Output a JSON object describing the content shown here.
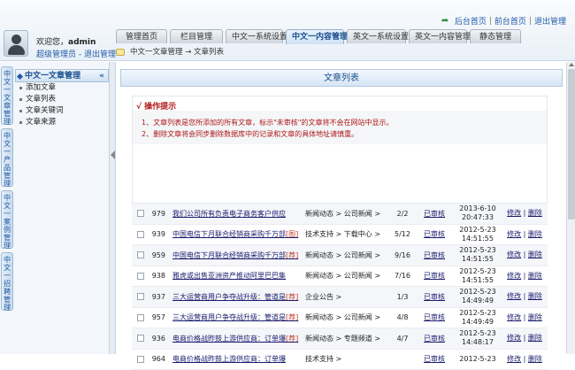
{
  "top": {
    "welcome_prefix": "欢迎您，",
    "username": "admin",
    "role": "超级管理员",
    "logout_inline": "退出管理",
    "links": [
      "后台首页",
      "前台首页",
      "退出管理"
    ]
  },
  "tabs": [
    {
      "label": "管理首页",
      "active": false
    },
    {
      "label": "栏目管理",
      "active": false
    },
    {
      "label": "中文一系统设置",
      "active": false
    },
    {
      "label": "中文一内容管理",
      "active": true
    },
    {
      "label": "英文一系统设置",
      "active": false
    },
    {
      "label": "英文一内容管理",
      "active": false
    },
    {
      "label": "静态管理",
      "active": false
    }
  ],
  "breadcrumb": "中文一文章管理 → 文章列表",
  "nav": {
    "vertical_tabs": [
      "中文一文章管理",
      "中文一产品管理",
      "中文一案例管理",
      "中文一招聘管理"
    ],
    "section_title": "中文一文章管理",
    "items": [
      "添加文章",
      "文章列表",
      "文章关键词",
      "文章来源"
    ]
  },
  "main": {
    "header": "文章列表",
    "notice_title": "操作提示",
    "notice_lines": [
      "1、文章列表是您所添加的所有文章，标示\"未审核\"的文章将不会在网站中显示。",
      "2、删除文章将会同步删除数据库中的记录和文章的具体地址请慎重。"
    ],
    "rows": [
      {
        "id": "979",
        "title": "我们公司所有负责电子商务客户供应",
        "tag": "",
        "category": "新闻动态 > 公司新闻 >",
        "count": "2/2",
        "status": "已审核",
        "date": "2013-6-10",
        "time": "20:47:33",
        "edit": "修改",
        "del": "删除"
      },
      {
        "id": "939",
        "title": "中国电信下月联合经销商采购千万部",
        "tag": "[图]",
        "category": "技术支持 > 下载中心 >",
        "count": "5/12",
        "status": "已审核",
        "date": "2012-5-23",
        "time": "14:51:55",
        "edit": "修改",
        "del": "删除"
      },
      {
        "id": "959",
        "title": "中国电信下月联合经销商采购千万部",
        "tag": "[荐]",
        "category": "新闻动态 > 公司新闻 >",
        "count": "9/16",
        "status": "已审核",
        "date": "2012-5-23",
        "time": "14:51:55",
        "edit": "修改",
        "del": "删除"
      },
      {
        "id": "938",
        "title": "雅虎或出售亚洲资产推动阿里巴巴集",
        "tag": "",
        "category": "新闻动态 > 公司新闻 >",
        "count": "7/16",
        "status": "已审核",
        "date": "2012-5-23",
        "time": "14:51:55",
        "edit": "修改",
        "del": "删除"
      },
      {
        "id": "937",
        "title": "三大运营商用户争夺战升级：管道是",
        "tag": "[荐]",
        "category": "企业公告 >",
        "count": "1/3",
        "status": "已审核",
        "date": "2012-5-23",
        "time": "14:49:49",
        "edit": "修改",
        "del": "删除"
      },
      {
        "id": "957",
        "title": "三大运营商用户争夺战升级：管道是",
        "tag": "[荐]",
        "category": "新闻动态 > 公司新闻 >",
        "count": "4/8",
        "status": "已审核",
        "date": "2012-5-23",
        "time": "14:49:49",
        "edit": "修改",
        "del": "删除"
      },
      {
        "id": "936",
        "title": "电商价格战昨鼓上游供应商：订单爆",
        "tag": "[荐]",
        "category": "新闻动态 > 专题频道 >",
        "count": "4/7",
        "status": "已审核",
        "date": "2012-5-23",
        "time": "14:48:17",
        "edit": "修改",
        "del": "删除"
      },
      {
        "id": "964",
        "title": "电商价格战昨鼓上游供应商：订单爆",
        "tag": "",
        "category": "技术支持 >",
        "count": "",
        "status": "已审核",
        "date": "2012-5-23",
        "time": "",
        "edit": "修改",
        "del": "删除"
      }
    ]
  }
}
